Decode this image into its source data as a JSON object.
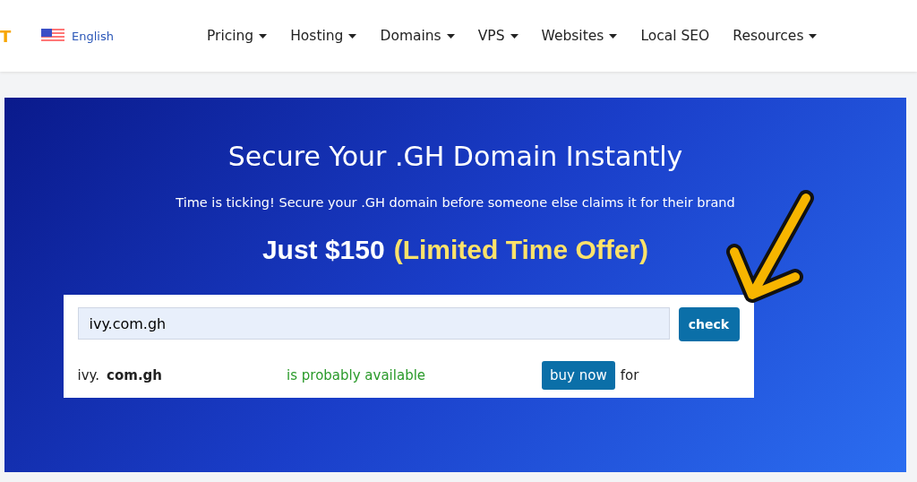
{
  "header": {
    "logo_fragment": "T",
    "language": "English",
    "nav": [
      {
        "label": "Pricing",
        "dropdown": true
      },
      {
        "label": "Hosting",
        "dropdown": true
      },
      {
        "label": "Domains",
        "dropdown": true
      },
      {
        "label": "VPS",
        "dropdown": true
      },
      {
        "label": "Websites",
        "dropdown": true
      },
      {
        "label": "Local SEO",
        "dropdown": false
      },
      {
        "label": "Resources",
        "dropdown": true
      }
    ]
  },
  "banner": {
    "title": "Secure Your .GH Domain Instantly",
    "subtitle": "Time is ticking! Secure your .GH domain before someone else claims it for their brand",
    "price": "Just $150",
    "offer": "(Limited Time Offer)"
  },
  "search": {
    "value": "ivy.com.gh",
    "button": "check"
  },
  "result": {
    "name": "ivy.",
    "extension": "com.gh",
    "status": "is probably available",
    "buy_button": "buy now",
    "price_label": "for"
  }
}
